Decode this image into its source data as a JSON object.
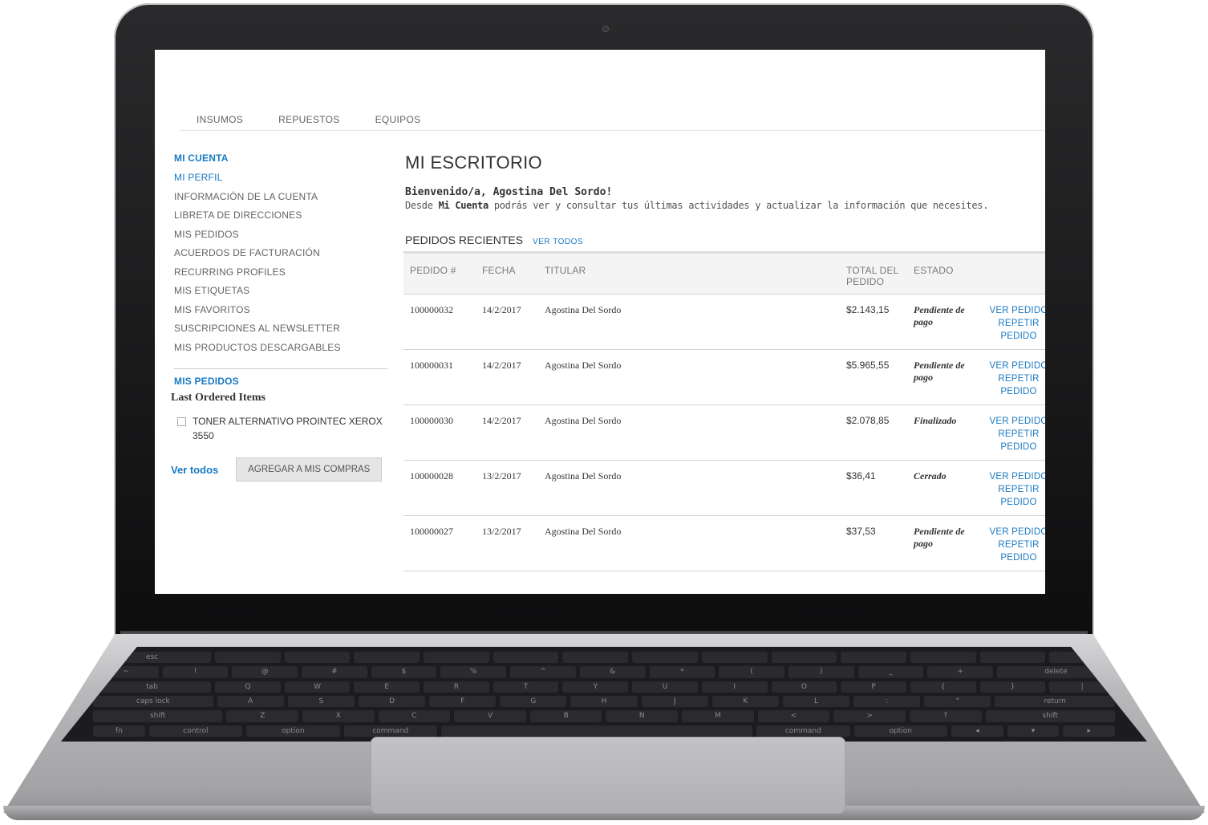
{
  "top_nav": [
    "INSUMOS",
    "REPUESTOS",
    "EQUIPOS"
  ],
  "sidebar": {
    "title": "MI CUENTA",
    "items": [
      {
        "label": "MI PERFIL",
        "active": true
      },
      {
        "label": "INFORMACIÓN DE LA CUENTA",
        "active": false
      },
      {
        "label": "LIBRETA DE DIRECCIONES",
        "active": false
      },
      {
        "label": "MIS PEDIDOS",
        "active": false
      },
      {
        "label": "ACUERDOS DE FACTURACIÓN",
        "active": false
      },
      {
        "label": "RECURRING PROFILES",
        "active": false
      },
      {
        "label": "MIS ETIQUETAS",
        "active": false
      },
      {
        "label": "MIS FAVORITOS",
        "active": false
      },
      {
        "label": "SUSCRIPCIONES AL NEWSLETTER",
        "active": false
      },
      {
        "label": "MIS PRODUCTOS DESCARGABLES",
        "active": false
      }
    ]
  },
  "last_ordered": {
    "section_title": "MIS PEDIDOS",
    "heading": "Last Ordered Items",
    "items": [
      "TONER ALTERNATIVO PROINTEC XEROX 3550"
    ],
    "view_all": "Ver todos",
    "add_button": "AGREGAR A MIS COMPRAS"
  },
  "main": {
    "title": "MI ESCRITORIO",
    "welcome": "Bienvenido/a, Agostina Del Sordo!",
    "desc_prefix": "Desde",
    "desc_bold": "Mi Cuenta",
    "desc_suffix": "podrás ver y consultar tus últimas actividades y actualizar la información que necesites."
  },
  "recent_orders": {
    "title": "PEDIDOS RECIENTES",
    "view_all": "VER TODOS",
    "columns": [
      "PEDIDO #",
      "FECHA",
      "TITULAR",
      "TOTAL DEL PEDIDO",
      "ESTADO",
      ""
    ],
    "rows": [
      {
        "id": "100000032",
        "date": "14/2/2017",
        "holder": "Agostina Del Sordo",
        "total": "$2.143,15",
        "status": "Pendiente de pago",
        "view": "VER PEDIDO",
        "reorder": "REPETIR PEDIDO"
      },
      {
        "id": "100000031",
        "date": "14/2/2017",
        "holder": "Agostina Del Sordo",
        "total": "$5.965,55",
        "status": "Pendiente de pago",
        "view": "VER PEDIDO",
        "reorder": "REPETIR PEDIDO"
      },
      {
        "id": "100000030",
        "date": "14/2/2017",
        "holder": "Agostina Del Sordo",
        "total": "$2.078,85",
        "status": "Finalizado",
        "view": "VER PEDIDO",
        "reorder": "REPETIR PEDIDO"
      },
      {
        "id": "100000028",
        "date": "13/2/2017",
        "holder": "Agostina Del Sordo",
        "total": "$36,41",
        "status": "Cerrado",
        "view": "VER PEDIDO",
        "reorder": "REPETIR PEDIDO"
      },
      {
        "id": "100000027",
        "date": "13/2/2017",
        "holder": "Agostina Del Sordo",
        "total": "$37,53",
        "status": "Pendiente de pago",
        "view": "VER PEDIDO",
        "reorder": "REPETIR PEDIDO"
      }
    ]
  },
  "keyboard": {
    "rows": [
      [
        "esc",
        "",
        "",
        "",
        "",
        "",
        "",
        "",
        "",
        "",
        "",
        "",
        "",
        ""
      ],
      [
        "~",
        "!",
        "@",
        "#",
        "$",
        "%",
        "^",
        "&",
        "*",
        "(",
        ")",
        "_",
        "+",
        "delete"
      ],
      [
        "tab",
        "Q",
        "W",
        "E",
        "R",
        "T",
        "Y",
        "U",
        "I",
        "O",
        "P",
        "{",
        "}",
        "|"
      ],
      [
        "caps lock",
        "A",
        "S",
        "D",
        "F",
        "G",
        "H",
        "J",
        "K",
        "L",
        ":",
        "\"",
        "return"
      ],
      [
        "shift",
        "Z",
        "X",
        "C",
        "V",
        "B",
        "N",
        "M",
        "<",
        ">",
        "?",
        "shift"
      ],
      [
        "fn",
        "control",
        "option",
        "command",
        "",
        "command",
        "option",
        "◂",
        "▾",
        "▸"
      ]
    ]
  },
  "colors": {
    "accent": "#1979c3",
    "text": "#333333",
    "muted": "#636363"
  }
}
